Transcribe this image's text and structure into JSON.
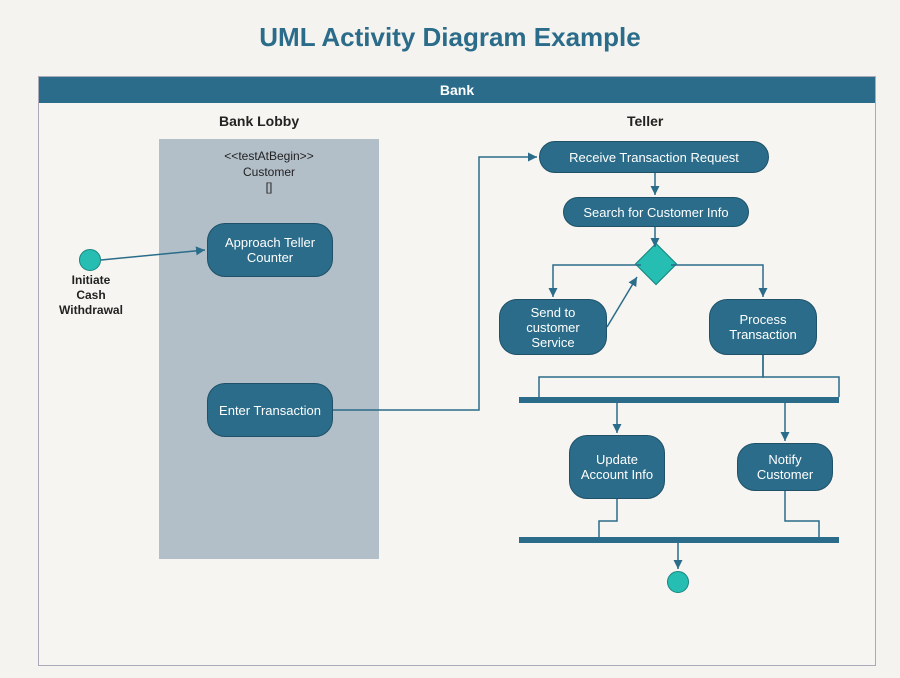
{
  "title": "UML Activity Diagram Example",
  "pool": {
    "name": "Bank"
  },
  "lanes": {
    "lobby": "Bank Lobby",
    "teller": "Teller"
  },
  "partition": {
    "stereotype": "<<testAtBegin>>",
    "name": "Customer",
    "guard": "[]"
  },
  "initial": {
    "label": "Initiate\nCash\nWithdrawal"
  },
  "activities": {
    "approach": "Approach Teller Counter",
    "enter": "Enter Transaction",
    "receive": "Receive Transaction Request",
    "search": "Search for Customer Info",
    "sendcs": "Send to customer Service",
    "process": "Process Transaction",
    "update": "Update Account Info",
    "notify": "Notify Customer"
  },
  "colors": {
    "primary": "#2a6c89",
    "accent": "#26bdb3",
    "bg": "#f4f3ef"
  }
}
